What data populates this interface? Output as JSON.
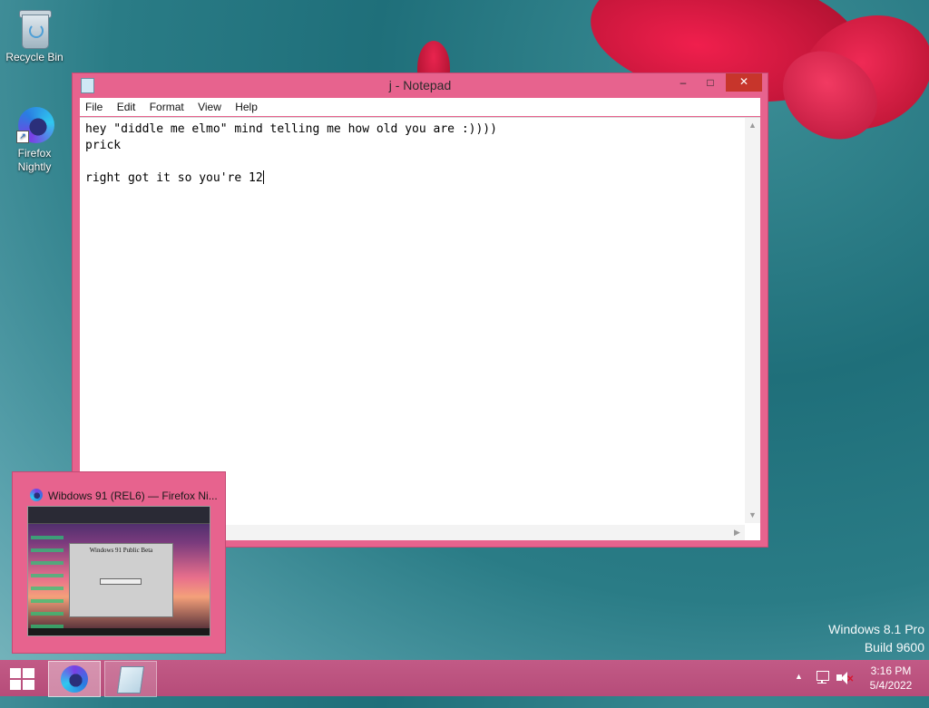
{
  "desktop": {
    "icons": [
      {
        "label": "Recycle Bin",
        "icon": "recycle-bin-icon"
      },
      {
        "label": "Firefox Nightly",
        "icon": "firefox-nightly-icon"
      }
    ]
  },
  "notepad": {
    "title": "j - Notepad",
    "controls": {
      "minimize": "–",
      "maximize": "□",
      "close": "✕"
    },
    "menu": [
      "File",
      "Edit",
      "Format",
      "View",
      "Help"
    ],
    "content": "hey \"diddle me elmo\" mind telling me how old you are :))))\nprick\n\nright got it so you're 12"
  },
  "thumbnail": {
    "title": "Wibdows 91 (REL6) — Firefox Ni...",
    "preview_dialog_title": "Windows 91 Public Beta"
  },
  "watermark": {
    "line1": "Windows 8.1 Pro",
    "line2": "Build 9600"
  },
  "taskbar": {
    "apps": [
      {
        "name": "Firefox Nightly",
        "icon": "firefox-icon",
        "active": true
      },
      {
        "name": "Notepad",
        "icon": "notepad-icon",
        "active": false
      }
    ],
    "tray": {
      "chevron": "▲",
      "time": "3:16 PM",
      "date": "5/4/2022"
    }
  },
  "colors": {
    "window_frame": "#e7638e",
    "taskbar": "#bc5380",
    "close_button": "#c7352b"
  }
}
